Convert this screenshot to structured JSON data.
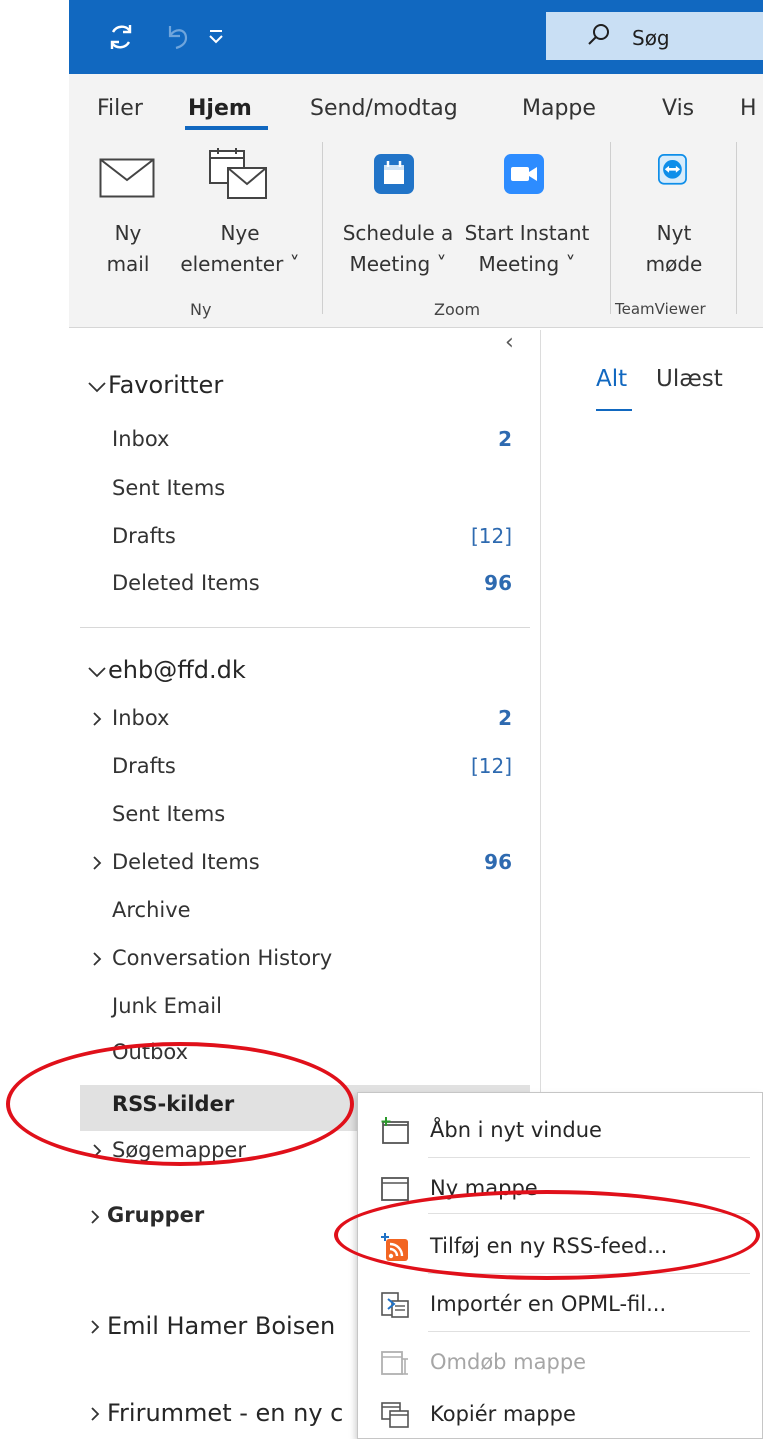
{
  "titlebar": {
    "color": "#1168c0",
    "icons": [
      "sync-icon",
      "undo-icon",
      "quick-access-dropdown-icon"
    ],
    "search_placeholder": "Søg"
  },
  "ribbon": {
    "tabs": [
      "Filer",
      "Hjem",
      "Send/modtag",
      "Mappe",
      "Vis",
      "H"
    ],
    "active_tab": "Hjem",
    "buttons": {
      "new_mail": [
        "Ny",
        "mail"
      ],
      "new_items": [
        "Nye",
        "elementer ˅"
      ],
      "schedule_meeting": [
        "Schedule a",
        "Meeting ˅"
      ],
      "start_instant": [
        "Start Instant",
        "Meeting ˅"
      ],
      "new_meeting": [
        "Nyt",
        "møde"
      ]
    },
    "groups": [
      "Ny",
      "Zoom",
      "TeamViewer"
    ]
  },
  "folderpane": {
    "collapse_glyph": "‹",
    "favorites": {
      "header": "Favoritter",
      "items": [
        {
          "label": "Inbox",
          "count": "2"
        },
        {
          "label": "Sent Items",
          "count": ""
        },
        {
          "label": "Drafts",
          "count": "[12]"
        },
        {
          "label": "Deleted Items",
          "count": "96"
        }
      ]
    },
    "account": {
      "header": "ehb@ffd.dk",
      "items": [
        {
          "label": "Inbox",
          "count": "2",
          "expand": true
        },
        {
          "label": "Drafts",
          "count": "[12]",
          "expand": false
        },
        {
          "label": "Sent Items",
          "count": "",
          "expand": false
        },
        {
          "label": "Deleted Items",
          "count": "96",
          "expand": true
        },
        {
          "label": "Archive",
          "count": "",
          "expand": false
        },
        {
          "label": "Conversation History",
          "count": "",
          "expand": true
        },
        {
          "label": "Junk Email",
          "count": "",
          "expand": false
        },
        {
          "label": "Outbox",
          "count": "",
          "expand": false
        },
        {
          "label": "RSS-kilder",
          "count": "",
          "expand": false
        },
        {
          "label": "Søgemapper",
          "count": "",
          "expand": true
        }
      ]
    },
    "groups_label": "Grupper",
    "other_mailboxes": [
      "Emil Hamer Boisen",
      "Frirummet - en ny c"
    ]
  },
  "messagelist": {
    "tabs": [
      "Alt",
      "Ulæst"
    ],
    "active_tab": "Alt"
  },
  "contextmenu": {
    "items": [
      {
        "label": "Åbn i nyt vindue",
        "icon": "open-new-window-icon",
        "enabled": true
      },
      {
        "label": "Ny mappe",
        "icon": "new-folder-icon",
        "enabled": true
      },
      {
        "label": "Tilføj en ny RSS-feed...",
        "icon": "add-rss-feed-icon",
        "enabled": true
      },
      {
        "label": "Importér en OPML-fil...",
        "icon": "import-opml-icon",
        "enabled": true
      },
      {
        "label": "Omdøb mappe",
        "icon": "rename-folder-icon",
        "enabled": false
      },
      {
        "label": "Kopiér mappe",
        "icon": "copy-folder-icon",
        "enabled": true
      }
    ]
  },
  "annotation_color": "#e0101a",
  "accent_color": "#1168c0",
  "count_color": "#2e6ab0"
}
